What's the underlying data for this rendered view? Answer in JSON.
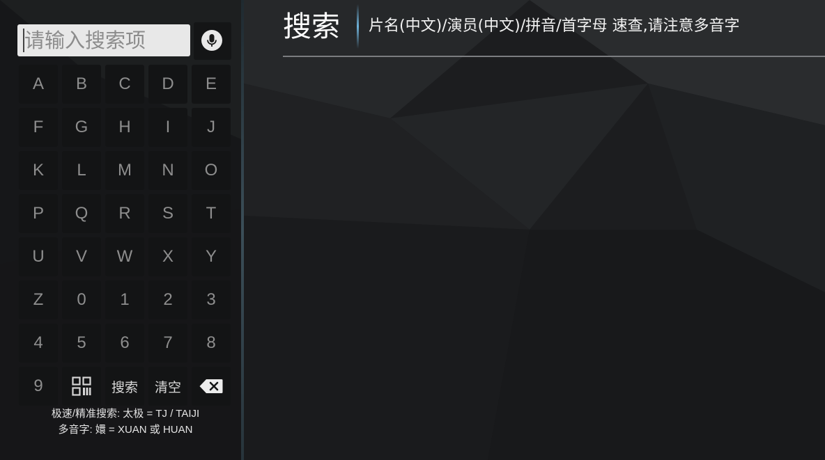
{
  "search": {
    "placeholder": "请输入搜索项",
    "value": ""
  },
  "icons": {
    "mic": "microphone-icon",
    "qr": "qr-code-icon",
    "backspace": "backspace-icon"
  },
  "header": {
    "title": "搜索",
    "subtitle": "片名(中文)/演员(中文)/拼音/首字母 速查,请注意多音字"
  },
  "keyboard": {
    "rows": [
      [
        "A",
        "B",
        "C",
        "D",
        "E"
      ],
      [
        "F",
        "G",
        "H",
        "I",
        "J"
      ],
      [
        "K",
        "L",
        "M",
        "N",
        "O"
      ],
      [
        "P",
        "Q",
        "R",
        "S",
        "T"
      ],
      [
        "U",
        "V",
        "W",
        "X",
        "Y"
      ],
      [
        "Z",
        "0",
        "1",
        "2",
        "3"
      ],
      [
        "4",
        "5",
        "6",
        "7",
        "8"
      ]
    ],
    "last_row": {
      "nine": "9",
      "search": "搜索",
      "clear": "清空"
    }
  },
  "hints": {
    "line1": "极速/精准搜索: 太极 = TJ / TAIJI",
    "line2": "多音字: 嬛 = XUAN 或 HUAN"
  },
  "colors": {
    "background": "#1d1e20",
    "key": "#131415",
    "accent": "#6fb3db"
  }
}
